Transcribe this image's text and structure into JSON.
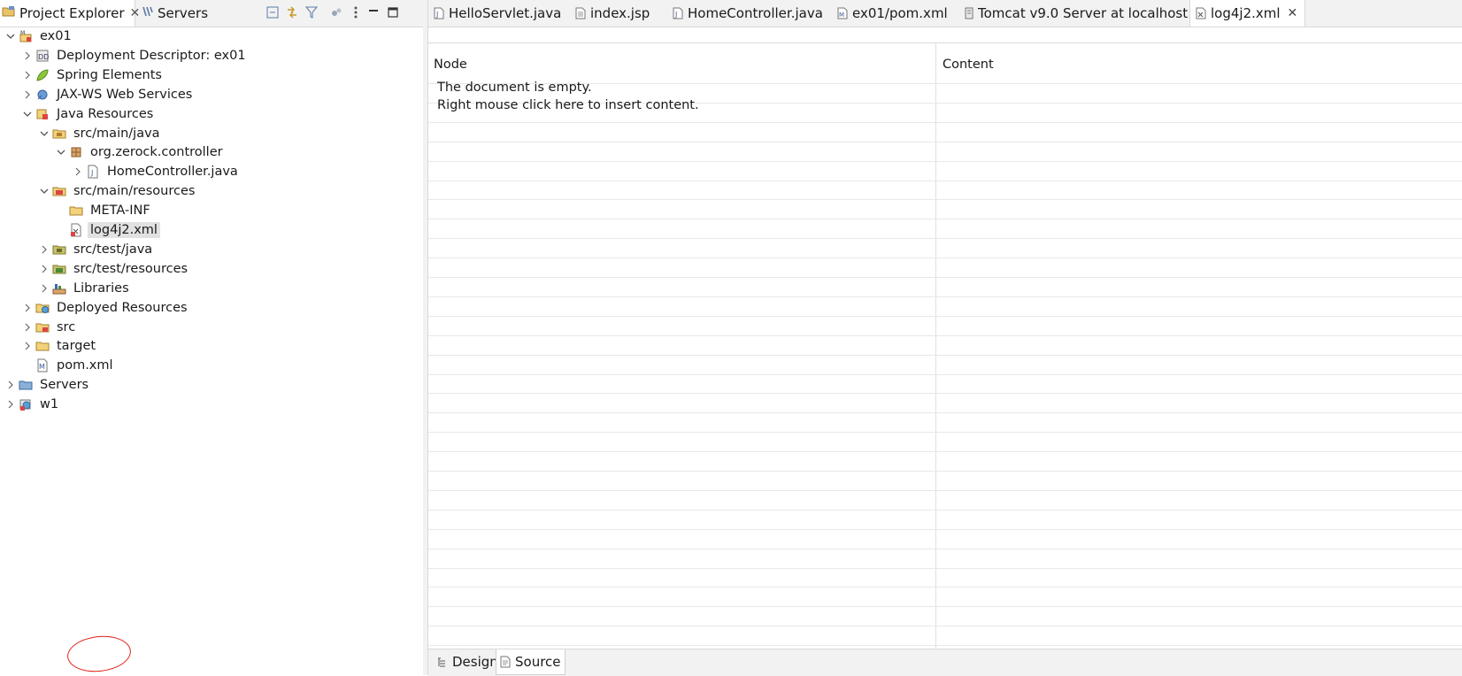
{
  "left_panel": {
    "tabs": [
      {
        "label": "Project Explorer",
        "icon": "project-explorer-icon",
        "active": true
      },
      {
        "label": "Servers",
        "icon": "servers-icon",
        "active": false
      }
    ],
    "toolbar": [
      "collapse-all-icon",
      "link-with-editor-icon",
      "filter-icon",
      "view-menu-icon",
      "more-icon",
      "minimize-icon",
      "maximize-icon"
    ],
    "tree": [
      {
        "label": "ex01",
        "depth": 0,
        "expanded": true,
        "icon": "maven-project-icon"
      },
      {
        "label": "Deployment Descriptor: ex01",
        "depth": 1,
        "expanded": false,
        "icon": "deployment-descriptor-icon"
      },
      {
        "label": "Spring Elements",
        "depth": 1,
        "expanded": false,
        "icon": "spring-leaf-icon"
      },
      {
        "label": "JAX-WS Web Services",
        "depth": 1,
        "expanded": false,
        "icon": "web-services-icon"
      },
      {
        "label": "Java Resources",
        "depth": 1,
        "expanded": true,
        "icon": "java-resources-icon"
      },
      {
        "label": "src/main/java",
        "depth": 2,
        "expanded": true,
        "icon": "source-folder-icon"
      },
      {
        "label": "org.zerock.controller",
        "depth": 3,
        "expanded": true,
        "icon": "package-icon"
      },
      {
        "label": "HomeController.java",
        "depth": 4,
        "expanded": false,
        "icon": "java-file-icon"
      },
      {
        "label": "src/main/resources",
        "depth": 2,
        "expanded": true,
        "icon": "resource-folder-icon"
      },
      {
        "label": "META-INF",
        "depth": 3,
        "expanded": null,
        "icon": "folder-icon"
      },
      {
        "label": "log4j2.xml",
        "depth": 3,
        "expanded": null,
        "icon": "xml-file-icon",
        "selected": true
      },
      {
        "label": "src/test/java",
        "depth": 2,
        "expanded": false,
        "icon": "test-source-folder-icon"
      },
      {
        "label": "src/test/resources",
        "depth": 2,
        "expanded": false,
        "icon": "test-resource-folder-icon"
      },
      {
        "label": "Libraries",
        "depth": 2,
        "expanded": false,
        "icon": "libraries-icon"
      },
      {
        "label": "Deployed Resources",
        "depth": 1,
        "expanded": false,
        "icon": "deployed-resources-icon"
      },
      {
        "label": "src",
        "depth": 1,
        "expanded": false,
        "icon": "src-folder-icon"
      },
      {
        "label": "target",
        "depth": 1,
        "expanded": false,
        "icon": "folder-icon"
      },
      {
        "label": "pom.xml",
        "depth": 1,
        "expanded": null,
        "icon": "maven-pom-icon"
      },
      {
        "label": "Servers",
        "depth": 0,
        "expanded": false,
        "icon": "servers-folder-icon"
      },
      {
        "label": "w1",
        "depth": 0,
        "expanded": false,
        "icon": "web-project-icon"
      }
    ]
  },
  "editor": {
    "tabs": [
      {
        "label": "HelloServlet.java",
        "icon": "java-file-icon",
        "active": false
      },
      {
        "label": "index.jsp",
        "icon": "jsp-file-icon",
        "active": false
      },
      {
        "label": "HomeController.java",
        "icon": "java-file-icon",
        "active": false
      },
      {
        "label": "ex01/pom.xml",
        "icon": "maven-pom-icon",
        "active": false
      },
      {
        "label": "Tomcat v9.0 Server at localhost",
        "icon": "server-icon",
        "active": false
      },
      {
        "label": "log4j2.xml",
        "icon": "xml-file-icon",
        "active": true
      }
    ],
    "close_glyph": "✕",
    "columns": {
      "node": "Node",
      "content": "Content"
    },
    "empty_line1": "The document is empty.",
    "empty_line2": "Right mouse click here to insert content.",
    "bottom_tabs": [
      {
        "label": "Design",
        "icon": "design-tab-icon",
        "active": false
      },
      {
        "label": "Source",
        "icon": "source-tab-icon",
        "active": true
      }
    ]
  },
  "colors": {
    "annotation": "#e0211b",
    "selection": "#e1e1e1"
  }
}
